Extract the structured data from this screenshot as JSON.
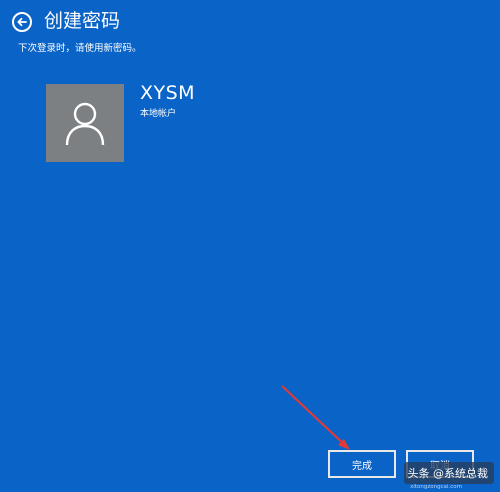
{
  "header": {
    "title": "创建密码",
    "subtitle": "下次登录时，请使用新密码。",
    "back_icon": "arrow-left-circle-icon"
  },
  "account": {
    "name": "XYSM",
    "type": "本地帐户",
    "avatar_icon": "user-silhouette-icon"
  },
  "footer": {
    "finish_label": "完成",
    "cancel_label": "取消"
  },
  "annotation": {
    "arrow_color": "#e53935"
  },
  "watermark": {
    "text": "头条 @系统总裁",
    "subtext": "xitongzongcai.com"
  },
  "colors": {
    "background": "#0a63c7",
    "avatar_bg": "#7d8083"
  }
}
